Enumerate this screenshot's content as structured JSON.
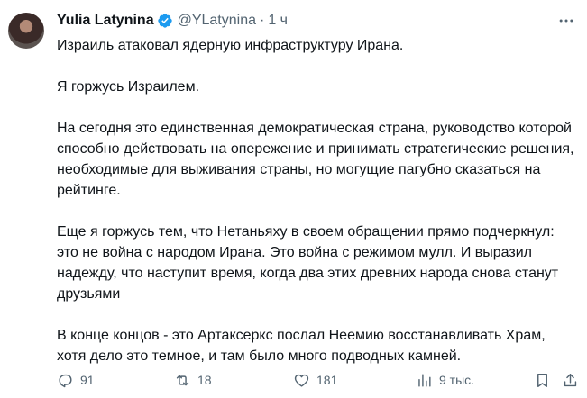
{
  "author": {
    "name": "Yulia Latynina",
    "handle": "@YLatynina",
    "separator": "·",
    "time": "1 ч"
  },
  "tweet": {
    "paragraphs": [
      "Израиль атаковал ядерную инфраструктуру Ирана.",
      "Я горжусь Израилем.",
      "На сегодня это единственная демократическая страна, руководство которой способно действовать на опережение и принимать стратегические решения, необходимые для выживания страны, но могущие пагубно сказаться на рейтинге.",
      "Еще я горжусь тем, что Нетаньяху в своем обращении прямо подчеркнул: это не война с народом Ирана. Это война с режимом мулл. И выразил надежду, что наступит время, когда два этих древних народа снова станут друзьями",
      "В конце концов - это Артаксеркс послал Неемию восстанавливать Храм, хотя дело это темное, и там было много подводных камней."
    ]
  },
  "actions": {
    "replies": "91",
    "retweets": "18",
    "likes": "181",
    "views": "9 тыс."
  },
  "icons": {
    "verified": "verified-badge-icon",
    "more": "more-icon",
    "reply": "reply-icon",
    "retweet": "retweet-icon",
    "like": "heart-icon",
    "views": "views-icon",
    "bookmark": "bookmark-icon",
    "share": "share-icon"
  },
  "colors": {
    "verified": "#1d9bf0",
    "text": "#0f1419",
    "secondary": "#536471"
  }
}
